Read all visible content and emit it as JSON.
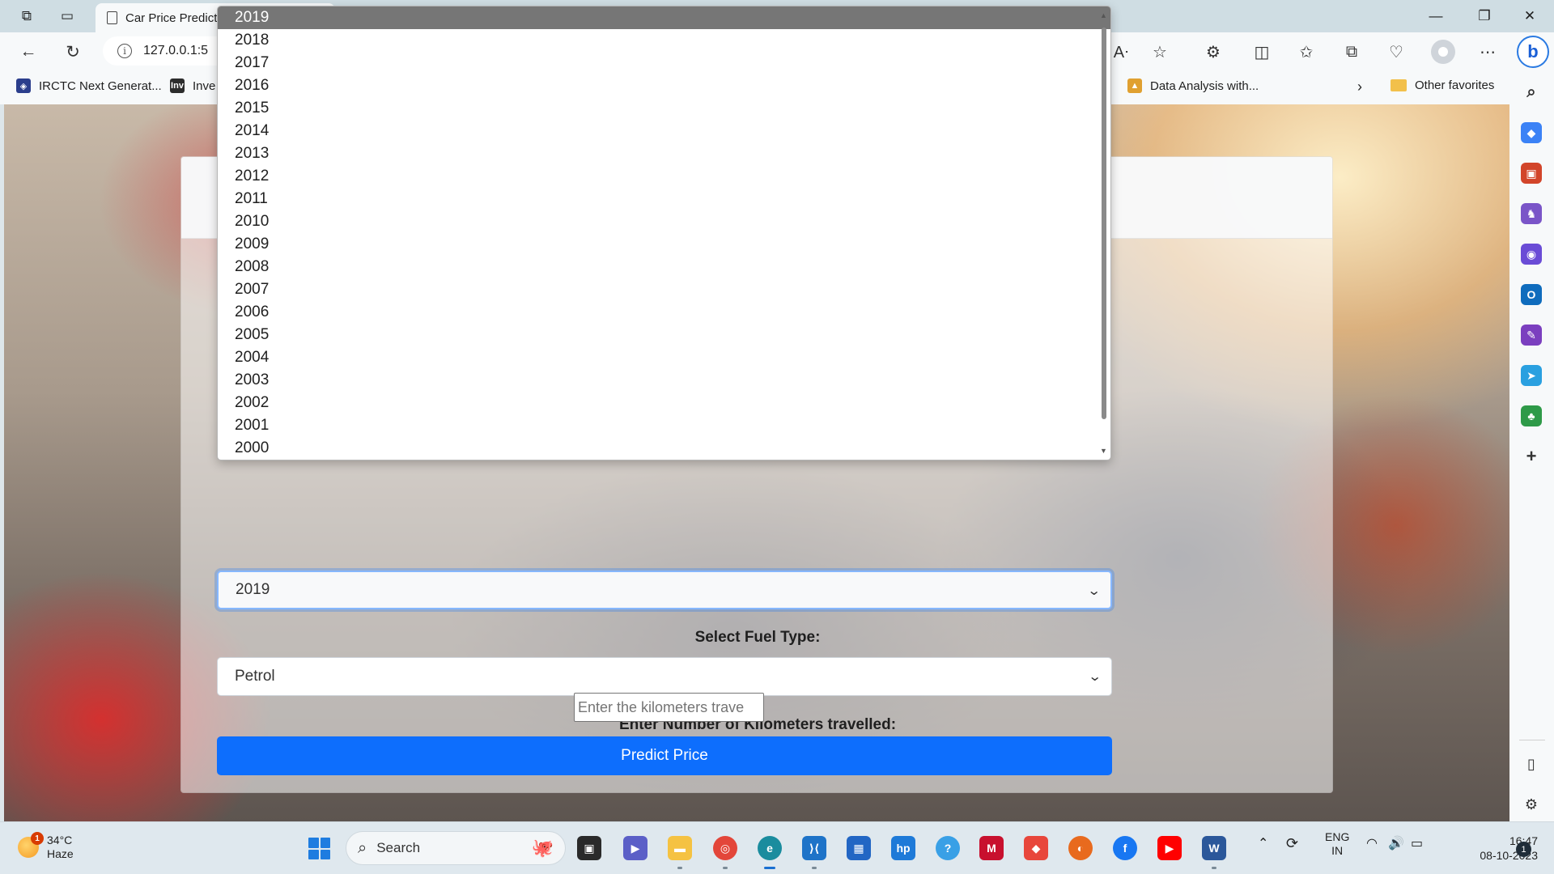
{
  "browser": {
    "tab_title": "Car Price Predict",
    "address": "127.0.0.1:5",
    "window_controls": [
      "minimize",
      "restore",
      "close"
    ],
    "favorites": [
      {
        "label": "IRCTC Next Generat...",
        "icon": "irctc-icon"
      },
      {
        "label": "Inve",
        "icon": "investing-icon"
      },
      {
        "label": "Data Analysis with...",
        "icon": "data-analysis-icon"
      }
    ],
    "other_favorites": "Other favorites"
  },
  "page": {
    "year_options": [
      "2019",
      "2018",
      "2017",
      "2016",
      "2015",
      "2014",
      "2013",
      "2012",
      "2011",
      "2010",
      "2009",
      "2008",
      "2007",
      "2006",
      "2005",
      "2004",
      "2003",
      "2002",
      "2001",
      "2000"
    ],
    "selected_year": "2019",
    "fuel_label": "Select Fuel Type:",
    "fuel_value": "Petrol",
    "km_label": "Enter Number of Kilometers travelled:",
    "km_placeholder": "Enter the kilometers trave",
    "predict_button": "Predict Price"
  },
  "taskbar": {
    "weather_temp": "34°C",
    "weather_desc": "Haze",
    "weather_badge": "1",
    "search_label": "Search",
    "lang_line1": "ENG",
    "lang_line2": "IN",
    "time": "16:47",
    "date": "08-10-2023",
    "notification_count": "1"
  },
  "colors": {
    "primary_button": "#0d6efd",
    "selected_option": "#767676",
    "focus_ring": "#86b7fe"
  }
}
